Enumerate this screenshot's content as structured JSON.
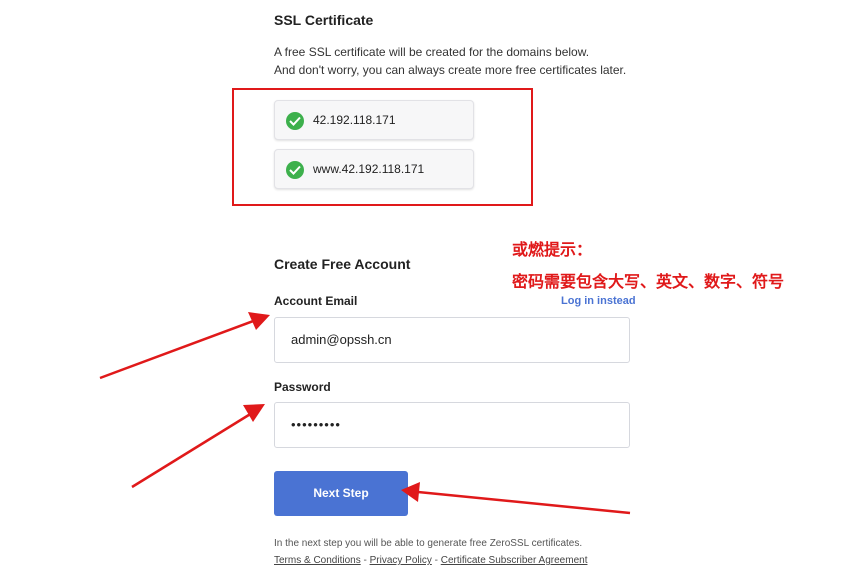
{
  "ssl": {
    "title": "SSL Certificate",
    "desc_line1": "A free SSL certificate will be created for the domains below.",
    "desc_line2": "And don't worry, you can always create more free certificates later.",
    "domains": [
      "42.192.118.171",
      "www.42.192.118.171"
    ]
  },
  "account": {
    "title": "Create Free Account",
    "email_label": "Account Email",
    "login_link": "Log in instead",
    "email_value": "admin@opssh.cn",
    "password_label": "Password",
    "password_value": "•••••••••",
    "next_button": "Next Step"
  },
  "footer": {
    "note": "In the next step you will be able to generate free ZeroSSL certificates.",
    "terms": "Terms & Conditions",
    "privacy": "Privacy Policy",
    "agreement": "Certificate Subscriber Agreement",
    "separator": " - "
  },
  "annotation": {
    "line1": "或燃提示：",
    "line2": "密码需要包含大写、英文、数字、符号",
    "color": "#e0191a"
  },
  "colors": {
    "accent": "#4a73d3",
    "success": "#3db04c",
    "highlight": "#e0191a"
  }
}
